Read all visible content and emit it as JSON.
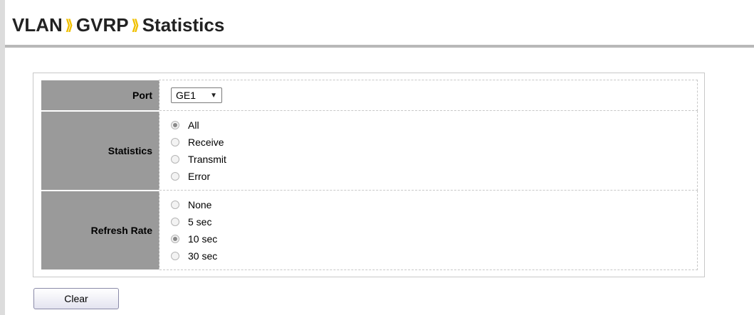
{
  "breadcrumb": {
    "items": [
      "VLAN",
      "GVRP",
      "Statistics"
    ],
    "separator": "⟫"
  },
  "form": {
    "port": {
      "label": "Port",
      "value": "GE1"
    },
    "statistics": {
      "label": "Statistics",
      "options": [
        {
          "label": "All",
          "selected": true
        },
        {
          "label": "Receive",
          "selected": false
        },
        {
          "label": "Transmit",
          "selected": false
        },
        {
          "label": "Error",
          "selected": false
        }
      ]
    },
    "refresh_rate": {
      "label": "Refresh Rate",
      "options": [
        {
          "label": "None",
          "selected": false
        },
        {
          "label": "5 sec",
          "selected": false
        },
        {
          "label": "10 sec",
          "selected": true
        },
        {
          "label": "30 sec",
          "selected": false
        }
      ]
    }
  },
  "buttons": {
    "clear_label": "Clear"
  },
  "colors": {
    "separator": "#f0c000",
    "label_bg": "#9a9a9a"
  }
}
